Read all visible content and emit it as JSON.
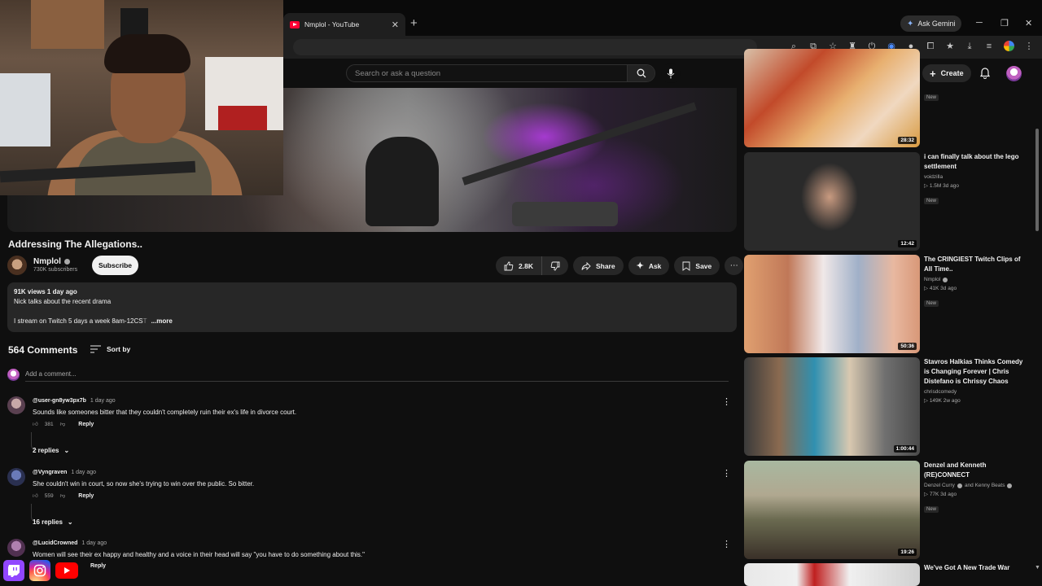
{
  "browser": {
    "tab_title": "Nmplol - YouTube",
    "ask_gemini": "Ask Gemini",
    "extension_badge": "115"
  },
  "masthead": {
    "search_placeholder": "Search or ask a question",
    "create_label": "Create"
  },
  "video": {
    "title": "Addressing The Allegations..",
    "channel": "Nmplol",
    "subscribers": "730K subscribers",
    "subscribe_label": "Subscribe",
    "likes": "2.8K",
    "share_label": "Share",
    "ask_label": "Ask",
    "save_label": "Save",
    "description": {
      "meta": "91K views  1 day ago",
      "line1": "Nick talks about the recent drama",
      "line2": "I stream on Twitch 5 days a week 8am-12CS",
      "line2_fade": "T",
      "more": "...more"
    }
  },
  "comments": {
    "count": "564 Comments",
    "sort_label": "Sort by",
    "add_placeholder": "Add a comment...",
    "items": [
      {
        "author": "@user-gn8yw3px7b",
        "time": "1 day ago",
        "text": "Sounds like someones bitter that they couldn't completely ruin their ex's life in divorce court.",
        "likes": "381",
        "reply": "Reply",
        "replies": "2 replies"
      },
      {
        "author": "@Vyngraven",
        "time": "1 day ago",
        "text": "She couldn't win in court, so now she's trying to win over the public. So bitter.",
        "likes": "559",
        "reply": "Reply",
        "replies": "16 replies"
      },
      {
        "author": "@LucidCrowned",
        "time": "1 day ago",
        "text": "Women will see their ex happy and healthy and a voice in their head will say \"you have to do something about this.\"",
        "likes": "",
        "reply": "Reply",
        "replies": ""
      }
    ]
  },
  "sidebar": {
    "items": [
      {
        "title": "",
        "channel": "",
        "meta": "",
        "badge": "New",
        "duration": "28:32"
      },
      {
        "title": "i can finally talk about the lego settlement",
        "channel": "voidzilla",
        "meta": "1.5M  3d ago",
        "badge": "New",
        "duration": "12:42"
      },
      {
        "title": "The CRINGIEST Twitch Clips of All Time..",
        "channel": "Nmplol",
        "meta": "41K  3d ago",
        "badge": "New",
        "duration": "50:36"
      },
      {
        "title": "Stavros Halkias Thinks Comedy is Changing Forever | Chris Distefano is Chrissy Chaos",
        "channel": "chrisdcomedy",
        "meta": "149K  2w ago",
        "badge": "",
        "duration": "1:00:44"
      },
      {
        "title": "Denzel and Kenneth (RE)CONNECT",
        "channel": "Denzel Curry",
        "channel_and": "and Kenny Beats",
        "meta": "77K  3d ago",
        "badge": "New",
        "duration": "19:26"
      },
      {
        "title": "We've Got A New Trade War",
        "channel": "",
        "meta": "",
        "badge": "",
        "duration": ""
      }
    ]
  },
  "colors": {
    "background": "#0f0f0f",
    "surface": "#272727",
    "youtube_red": "#ff0033",
    "twitch_purple": "#9146ff"
  }
}
